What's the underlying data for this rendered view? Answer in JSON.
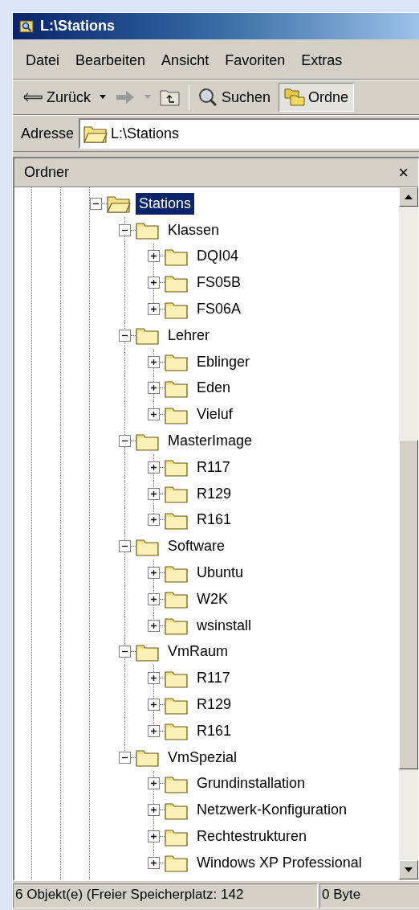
{
  "window": {
    "title": "L:\\Stations"
  },
  "menu": [
    "Datei",
    "Bearbeiten",
    "Ansicht",
    "Favoriten",
    "Extras"
  ],
  "toolbar": {
    "back": {
      "label": "Zurück",
      "disabled": false
    },
    "forward": {
      "disabled": true
    },
    "search": {
      "label": "Suchen"
    },
    "folders": {
      "label": "Ordne",
      "selected": true
    }
  },
  "address": {
    "label": "Adresse",
    "value": "L:\\Stations"
  },
  "panel": {
    "title": "Ordner",
    "close": "×"
  },
  "tree": [
    {
      "label": "Stations",
      "expanded": true,
      "selected": true,
      "children": [
        {
          "label": "Klassen",
          "expanded": true,
          "selected": false,
          "children": [
            {
              "label": "DQI04",
              "expanded": false,
              "selected": false
            },
            {
              "label": "FS05B",
              "expanded": false,
              "selected": false
            },
            {
              "label": "FS06A",
              "expanded": false,
              "selected": false
            }
          ]
        },
        {
          "label": "Lehrer",
          "expanded": true,
          "selected": false,
          "children": [
            {
              "label": "Eblinger",
              "expanded": false,
              "selected": false
            },
            {
              "label": "Eden",
              "expanded": false,
              "selected": false
            },
            {
              "label": "Vieluf",
              "expanded": false,
              "selected": false
            }
          ]
        },
        {
          "label": "MasterImage",
          "expanded": true,
          "selected": false,
          "children": [
            {
              "label": "R117",
              "expanded": false,
              "selected": false
            },
            {
              "label": "R129",
              "expanded": false,
              "selected": false
            },
            {
              "label": "R161",
              "expanded": false,
              "selected": false
            }
          ]
        },
        {
          "label": "Software",
          "expanded": true,
          "selected": false,
          "children": [
            {
              "label": "Ubuntu",
              "expanded": false,
              "selected": false
            },
            {
              "label": "W2K",
              "expanded": false,
              "selected": false
            },
            {
              "label": "wsinstall",
              "expanded": false,
              "selected": false
            }
          ]
        },
        {
          "label": "VmRaum",
          "expanded": true,
          "selected": false,
          "children": [
            {
              "label": "R117",
              "expanded": false,
              "selected": false
            },
            {
              "label": "R129",
              "expanded": false,
              "selected": false
            },
            {
              "label": "R161",
              "expanded": false,
              "selected": false
            }
          ]
        },
        {
          "label": "VmSpezial",
          "expanded": true,
          "selected": false,
          "children": [
            {
              "label": "Grundinstallation",
              "expanded": false,
              "selected": false
            },
            {
              "label": "Netzwerk-Konfiguration",
              "expanded": false,
              "selected": false
            },
            {
              "label": "Rechtestrukturen",
              "expanded": false,
              "selected": false
            },
            {
              "label": "Windows XP Professional",
              "expanded": false,
              "selected": false
            }
          ]
        }
      ]
    }
  ],
  "status_bar": [
    "6 Objekt(e)  (Freier Speicherplatz: 142",
    "0 Byte"
  ]
}
